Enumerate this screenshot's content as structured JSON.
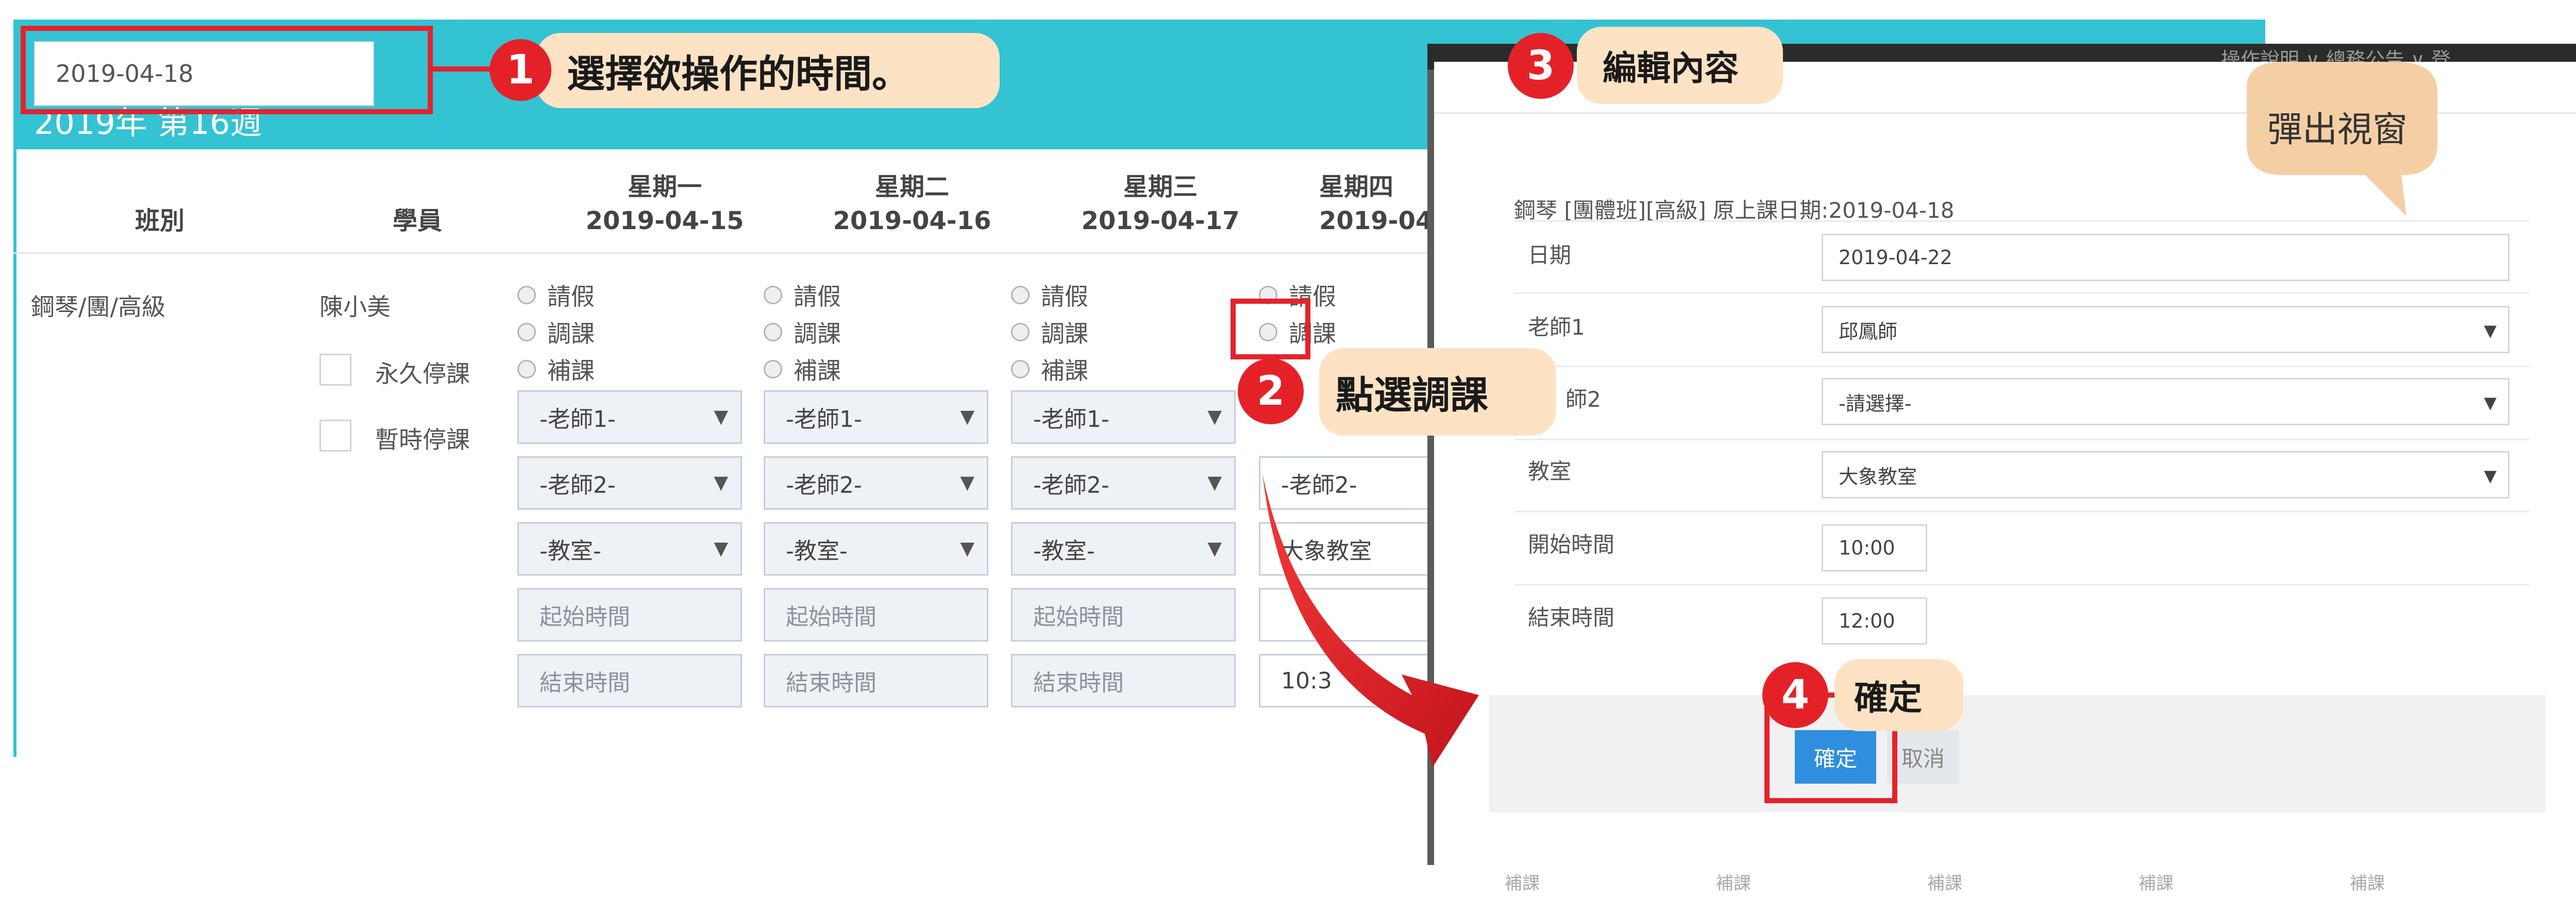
{
  "schedule": {
    "date_picker_value": "2019-04-18",
    "week_title": "2019年 第16週",
    "columns": {
      "class": "班別",
      "student": "學員",
      "days": [
        {
          "weekday": "星期一",
          "date": "2019-04-15"
        },
        {
          "weekday": "星期二",
          "date": "2019-04-16"
        },
        {
          "weekday": "星期三",
          "date": "2019-04-17"
        },
        {
          "weekday": "星期四",
          "date": "2019-04"
        }
      ]
    },
    "row": {
      "class_name": "鋼琴/團/高級",
      "student_name": "陳小美",
      "option_permanent_stop": "永久停課",
      "option_temporary_stop": "暫時停課",
      "radio_leave": "請假",
      "radio_reschedule": "調課",
      "radio_makeup": "補課",
      "teacher1_placeholder": "-老師1-",
      "teacher2_placeholder": "-老師2-",
      "classroom_placeholder": "-教室-",
      "start_time_placeholder": "起始時間",
      "end_time_placeholder": "結束時間",
      "day4_teacher2": "-老師2-",
      "day4_classroom": "大象教室",
      "day4_end_time": "10:3"
    }
  },
  "modal": {
    "title": "鋼琴 [團體班][高級] 原上課日期:2019-04-18",
    "top_menu": "操作說明 ∨   總務公告 ∨   登",
    "fields": {
      "date_label": "日期",
      "date_value": "2019-04-22",
      "teacher1_label": "老師1",
      "teacher1_value": "邱鳳師",
      "teacher2_label": "師2",
      "teacher2_value": "-請選擇-",
      "classroom_label": "教室",
      "classroom_value": "大象教室",
      "start_label": "開始時間",
      "start_value": "10:00",
      "end_label": "結束時間",
      "end_value": "12:00"
    },
    "confirm_button": "確定",
    "cancel_button": "取消",
    "bottom_faint_text": "補課"
  },
  "annotations": {
    "step1_number": "1",
    "step1_text": "選擇欲操作的時間。",
    "step2_number": "2",
    "step2_text": "點選調課",
    "step3_number": "3",
    "step3_text": "編輯內容",
    "step4_number": "4",
    "step4_text": "確定",
    "popup_bubble": "彈出視窗"
  },
  "colors": {
    "teal_header": "#33c3d3",
    "annotation_red": "#e4232b",
    "callout_bg": "#fde2c4",
    "popup_bubble": "#f5cfa4",
    "confirm_blue": "#2f8fde"
  },
  "icons": {
    "dropdown": "caret-down-icon",
    "arrow": "curved-arrow-icon"
  }
}
